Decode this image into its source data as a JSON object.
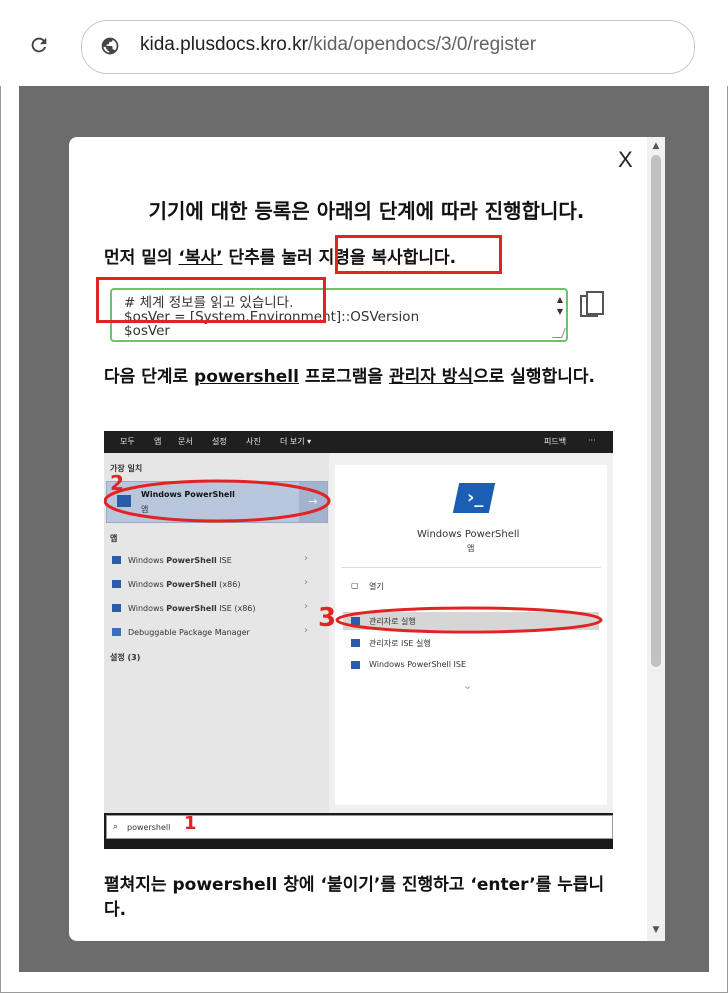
{
  "browser": {
    "url_host": "kida.plusdocs.kro.kr",
    "url_path": "/kida/opendocs/3/0/register"
  },
  "modal": {
    "close_label": "X",
    "title": "기기에 대한 등록은 아래의 단계에 따라 진행합니다.",
    "step1": {
      "prefix": "먼저 밑의 ",
      "copy_word": "‘복사’",
      "middle": " 단추를 눌러 ",
      "highlight": "지령을 복사합니다."
    },
    "code_lines": "# 체계 정보를 읽고 있습니다.\n$osVer = [System.Environment]::OSVersion\n$osVer",
    "step2": {
      "prefix": "다음 단계로 ",
      "program": "powershell",
      "middle": " 프로그램을 ",
      "mode": "관리자 방식",
      "suffix": "으로 실행합니다."
    },
    "step3": {
      "prefix": "펼쳐지는 ",
      "program": "powershell",
      "middle": " 창에 ",
      "paste": "‘붙이기’",
      "middle2": "를 진행하고 ",
      "enter": "‘enter’",
      "suffix": "를 누릅니다."
    }
  },
  "screenshot": {
    "tabs": [
      "모두",
      "앱",
      "문서",
      "설정",
      "사진",
      "더 보기 ▾",
      "피드백",
      "···"
    ],
    "best_match_header": "가장 일치",
    "best_match_title": "Windows PowerShell",
    "best_match_sub": "앱",
    "apps_header": "앱",
    "apps": [
      {
        "pre": "Windows ",
        "bold": "PowerShell",
        "post": " ISE"
      },
      {
        "pre": "Windows ",
        "bold": "PowerShell",
        "post": " (x86)"
      },
      {
        "pre": "Windows ",
        "bold": "PowerShell",
        "post": " ISE (x86)"
      },
      {
        "pre": "Debuggable Package Manager",
        "bold": "",
        "post": ""
      }
    ],
    "settings_header": "설정 (3)",
    "right_title": "Windows PowerShell",
    "right_sub": "앱",
    "actions": [
      "열기",
      "관리자로 실행",
      "관리자로 ISE 실행",
      "Windows PowerShell ISE"
    ],
    "search_text": "powershell",
    "annotations": [
      "1",
      "2",
      "3"
    ]
  }
}
